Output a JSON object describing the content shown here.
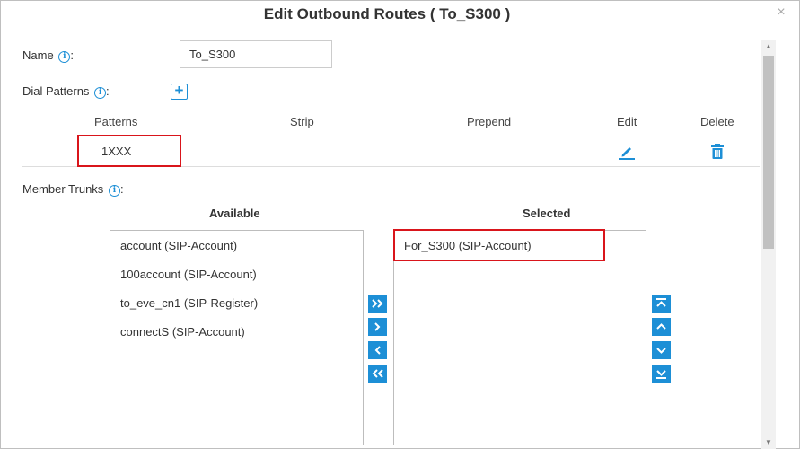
{
  "dialog": {
    "title": "Edit Outbound Routes ( To_S300 )",
    "close_glyph": "×"
  },
  "form": {
    "name_label": "Name",
    "name_colon": ":",
    "name_value": "To_S300",
    "dial_patterns_label": "Dial Patterns",
    "dial_patterns_colon": ":",
    "member_trunks_label": "Member Trunks",
    "member_trunks_colon": ":"
  },
  "patterns_table": {
    "headers": {
      "patterns": "Patterns",
      "strip": "Strip",
      "prepend": "Prepend",
      "edit": "Edit",
      "delete": "Delete"
    },
    "rows": [
      {
        "pattern": "1XXX",
        "strip": "",
        "prepend": ""
      }
    ]
  },
  "trunks": {
    "available_title": "Available",
    "selected_title": "Selected",
    "available": [
      "account (SIP-Account)",
      "100account (SIP-Account)",
      "to_eve_cn1 (SIP-Register)",
      "connectS (SIP-Account)"
    ],
    "selected": [
      "For_S300 (SIP-Account)"
    ]
  },
  "icons": {
    "info": "info-icon",
    "add": "plus-square-icon",
    "edit": "pencil-icon",
    "delete": "trash-icon",
    "move_all_right": "double-chevron-right-icon",
    "move_right": "chevron-right-icon",
    "move_left": "chevron-left-icon",
    "move_all_left": "double-chevron-left-icon",
    "move_top": "move-to-top-icon",
    "move_up": "chevron-up-icon",
    "move_down": "chevron-down-icon",
    "move_bottom": "move-to-bottom-icon"
  },
  "colors": {
    "accent": "#1d8fd6",
    "highlight_box": "#d9151b"
  }
}
